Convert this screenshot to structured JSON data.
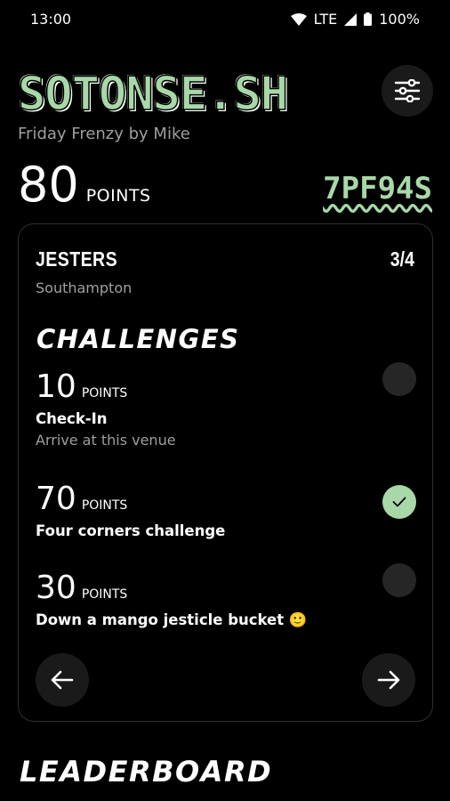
{
  "status_bar": {
    "time": "13:00",
    "network": "LTE",
    "battery": "100%",
    "icons": [
      "wifi-icon",
      "signal-icon",
      "battery-icon"
    ]
  },
  "header": {
    "app_title": "SOTONSE.SH",
    "subtitle": "Friday Frenzy by Mike",
    "settings_icon": "sliders-icon"
  },
  "score": {
    "points": "80",
    "unit": "POINTS",
    "game_code": "7PF94S"
  },
  "venue_card": {
    "name": "JESTERS",
    "progress": "3/4",
    "city": "Southampton",
    "challenges_heading": "CHALLENGES",
    "challenges": [
      {
        "points": "10",
        "unit": "POINTS",
        "title": "Check-In",
        "description": "Arrive at this venue",
        "completed": false
      },
      {
        "points": "70",
        "unit": "POINTS",
        "title": "Four corners challenge",
        "completed": true
      },
      {
        "points": "30",
        "unit": "POINTS",
        "title": "Down a mango jesticle bucket 🙂",
        "completed": false
      }
    ],
    "prev_icon": "arrow-left-icon",
    "next_icon": "arrow-right-icon"
  },
  "leaderboard": {
    "heading": "LEADERBOARD"
  },
  "colors": {
    "accent": "#a8d8a8",
    "background": "#000000",
    "muted": "#9e9e9e"
  }
}
